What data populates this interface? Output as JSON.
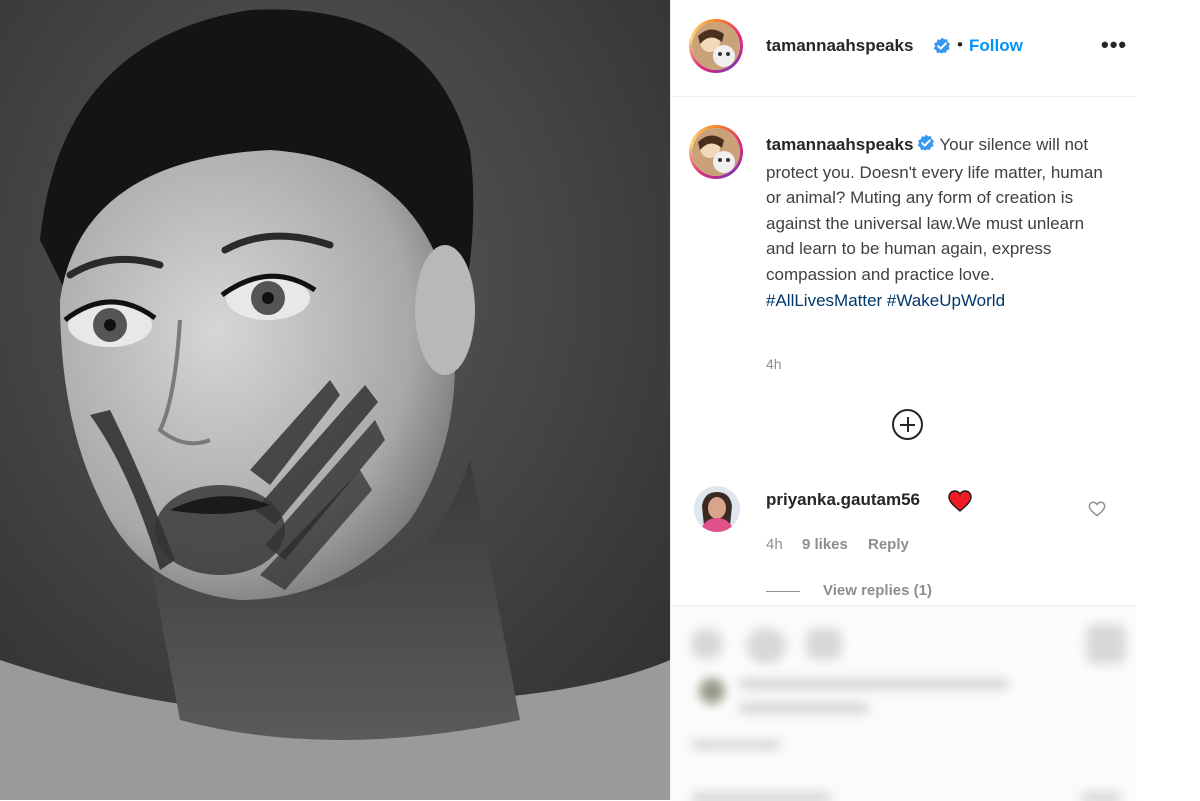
{
  "post": {
    "username": "tamannaahspeaks",
    "separator": "•",
    "follow_label": "Follow",
    "more_label": "•••",
    "caption": {
      "text": "Your silence will not protect you. Doesn't every life matter, human or animal? Muting any form of creation is against the universal law.We must unlearn and learn to be human again, express compassion and practice love.",
      "hashtags": "#AllLivesMatter #WakeUpWorld",
      "time": "4h"
    }
  },
  "comments": [
    {
      "username": "priyanka.gautam56",
      "emoji": "heart-emoji",
      "time": "4h",
      "likes": "9 likes",
      "reply_label": "Reply",
      "view_replies_label": "View replies (1)"
    }
  ],
  "icons": {
    "verified_badge": "verified-badge-icon",
    "add_comment": "plus-circle-icon",
    "like": "heart-outline-icon"
  },
  "colors": {
    "link_blue": "#0095f6",
    "hashtag": "#00376b",
    "verified": "#3897f0",
    "heart_red": "#ed1c24"
  }
}
